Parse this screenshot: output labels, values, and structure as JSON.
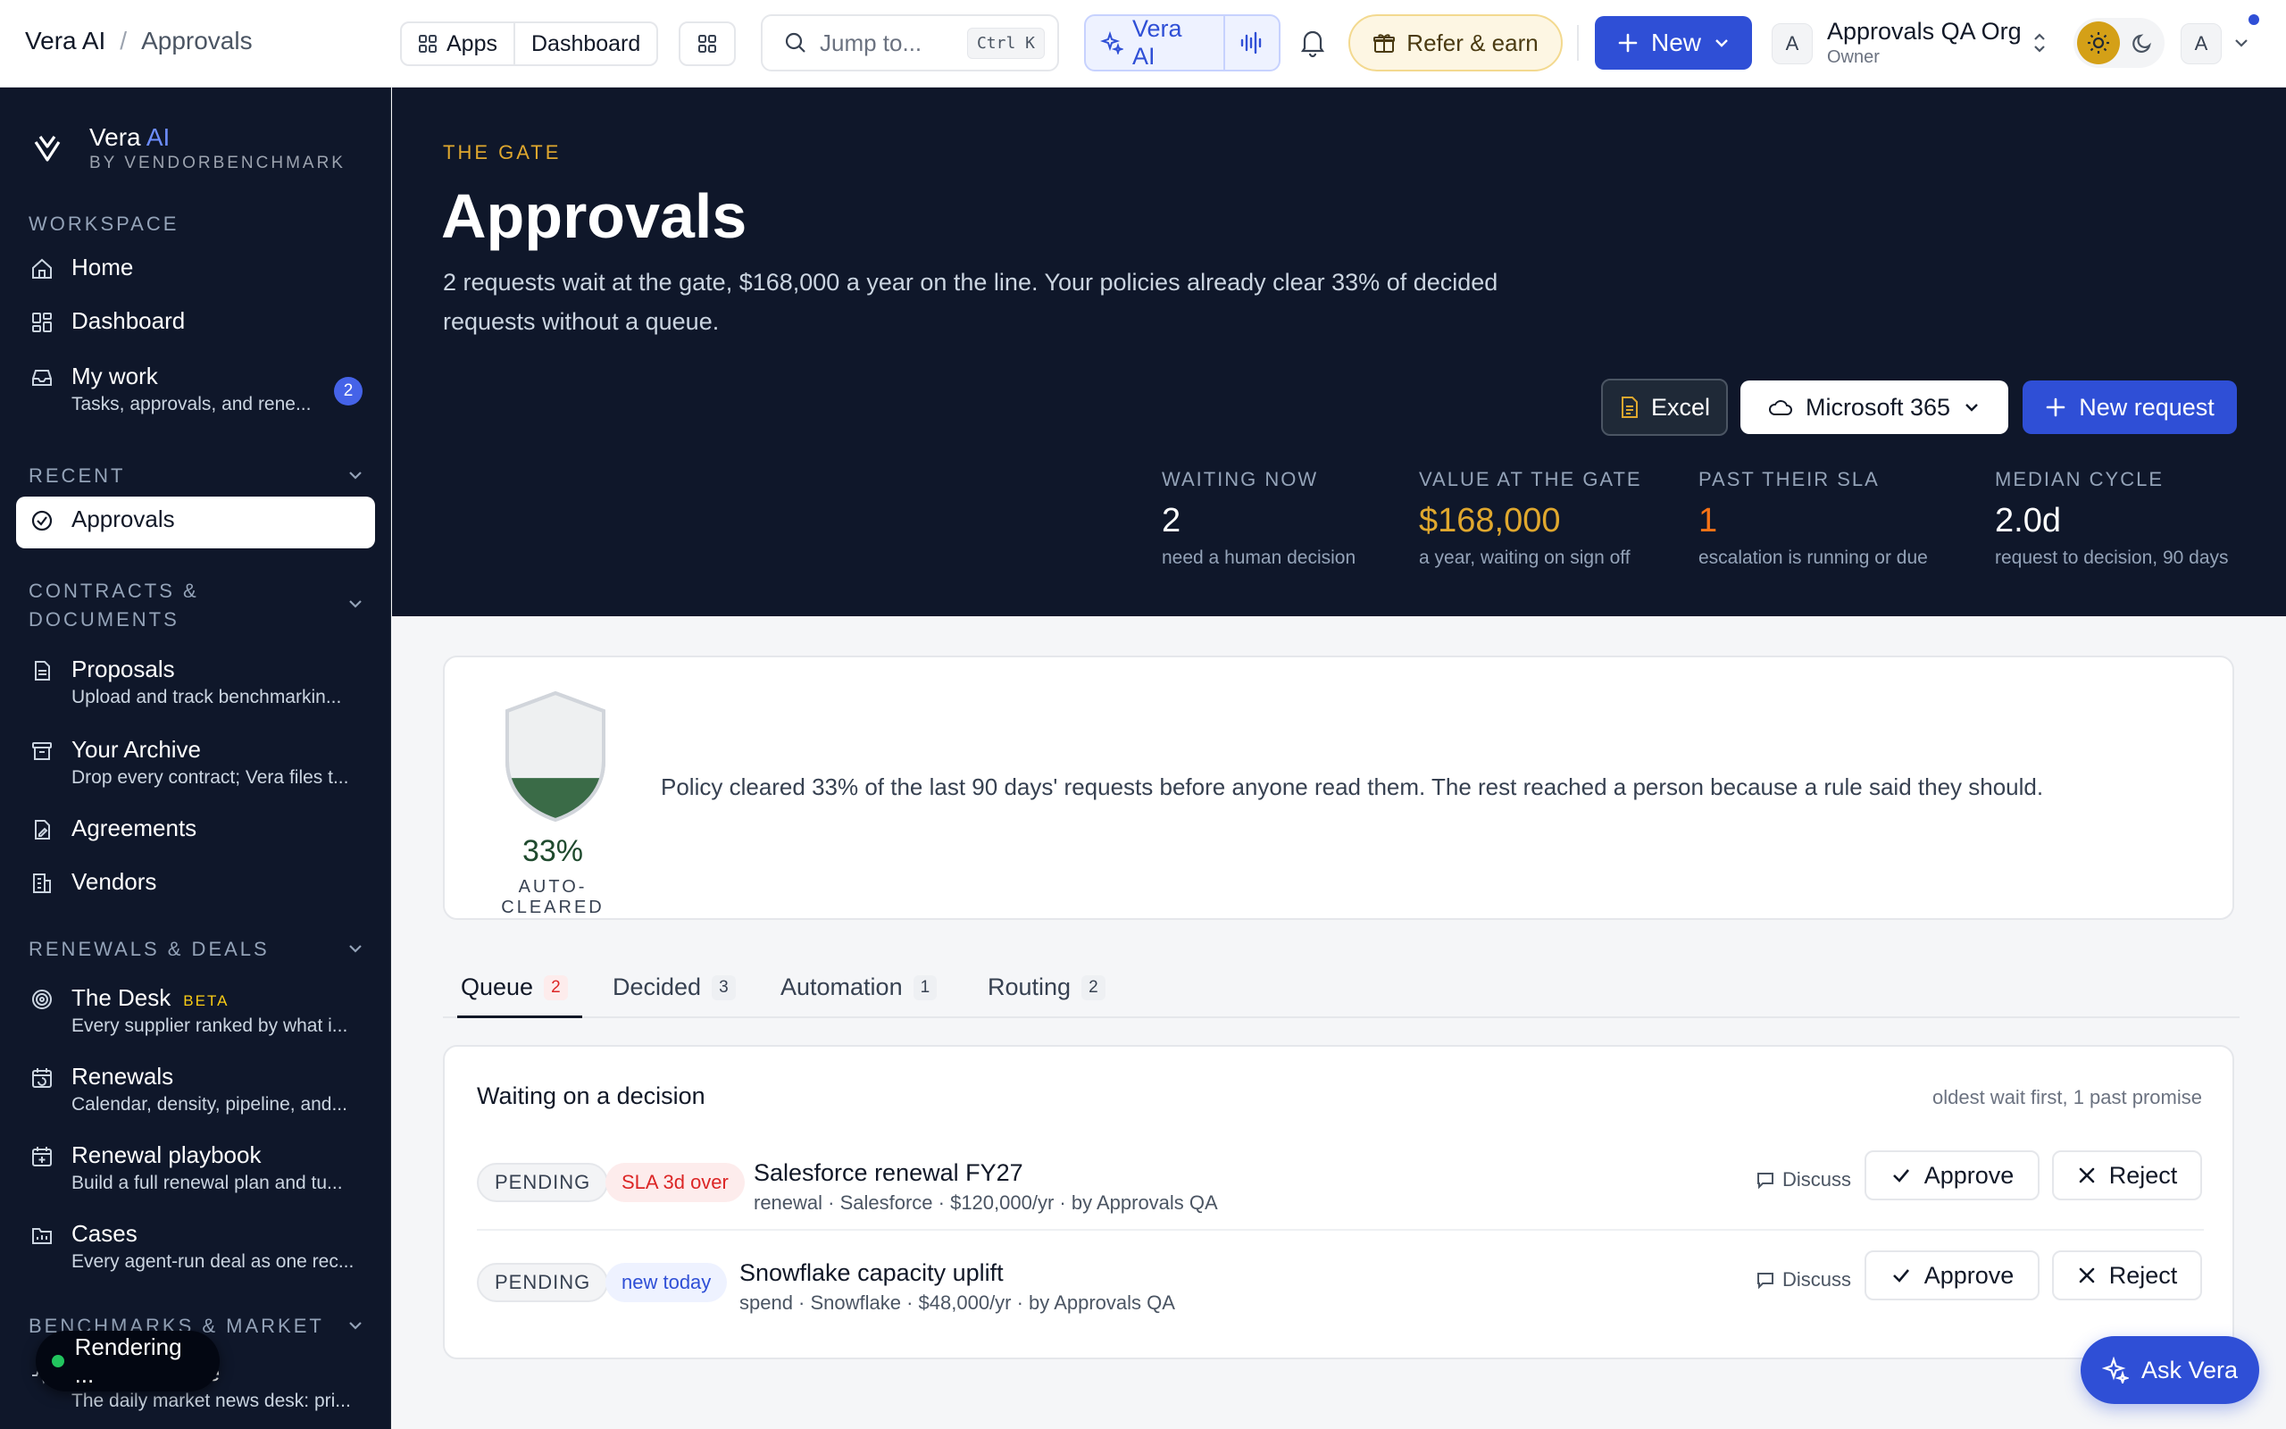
{
  "breadcrumb": {
    "app": "Vera AI",
    "separator": "/",
    "page": "Approvals"
  },
  "topbar": {
    "apps_label": "Apps",
    "dashboard_label": "Dashboard",
    "search_placeholder": "Jump to...",
    "search_shortcut": "Ctrl K",
    "vera_ai_label": "Vera AI",
    "refer_label": "Refer & earn",
    "new_label": "New",
    "org_initial": "A",
    "org_name": "Approvals QA Org",
    "org_role": "Owner",
    "user_initial": "A"
  },
  "sidebar": {
    "brand_name": "Vera",
    "brand_ai": "AI",
    "brand_sub": "BY VENDORBENCHMARK",
    "sections": {
      "workspace": "WORKSPACE",
      "recent": "RECENT",
      "contracts": "CONTRACTS &",
      "contracts2": "DOCUMENTS",
      "renewals": "RENEWALS & DEALS",
      "benchmarks": "BENCHMARKS & MARKET"
    },
    "items": {
      "home": {
        "label": "Home"
      },
      "dashboard": {
        "label": "Dashboard"
      },
      "my_work": {
        "label": "My work",
        "desc": "Tasks, approvals, and rene...",
        "badge": "2"
      },
      "approvals": {
        "label": "Approvals"
      },
      "proposals": {
        "label": "Proposals",
        "desc": "Upload and track benchmarkin..."
      },
      "archive": {
        "label": "Your Archive",
        "desc": "Drop every contract; Vera files t..."
      },
      "agreements": {
        "label": "Agreements"
      },
      "vendors": {
        "label": "Vendors"
      },
      "desk": {
        "label": "The Desk",
        "tag": "BETA",
        "desc": "Every supplier ranked by what i..."
      },
      "renewals": {
        "label": "Renewals",
        "desc": "Calendar, density, pipeline, and..."
      },
      "playbook": {
        "label": "Renewal playbook",
        "desc": "Build a full renewal plan and tu..."
      },
      "cases": {
        "label": "Cases",
        "desc": "Every agent-run deal as one rec..."
      },
      "wire": {
        "label": "The Vera Wire",
        "desc": "The daily market news desk: pri..."
      }
    },
    "rendering_label": "Rendering ..."
  },
  "hero": {
    "eyebrow": "THE GATE",
    "title": "Approvals",
    "lede": "2 requests wait at the gate, $168,000 a year on the line. Your policies already clear 33% of decided requests without a queue.",
    "excel_label": "Excel",
    "ms_label": "Microsoft 365",
    "new_request_label": "New request",
    "stats": {
      "waiting": {
        "label": "WAITING NOW",
        "value": "2",
        "sub": "need a human decision"
      },
      "value": {
        "label": "VALUE AT THE GATE",
        "value": "$168,000",
        "sub": "a year, waiting on sign off"
      },
      "sla": {
        "label": "PAST THEIR SLA",
        "value": "1",
        "sub": "escalation is running or due"
      },
      "cycle": {
        "label": "MEDIAN CYCLE",
        "value": "2.0d",
        "sub": "request to decision, 90 days"
      }
    }
  },
  "policy": {
    "auto_cleared_fraction": 0.33,
    "percent": "33%",
    "label": "AUTO-CLEARED",
    "text": "Policy cleared 33% of the last 90 days' requests before anyone read them. The rest reached a person because a rule said they should."
  },
  "tabs": {
    "queue": {
      "label": "Queue",
      "count": "2"
    },
    "decided": {
      "label": "Decided",
      "count": "3"
    },
    "automation": {
      "label": "Automation",
      "count": "1"
    },
    "routing": {
      "label": "Routing",
      "count": "2"
    }
  },
  "queue": {
    "heading": "Waiting on a decision",
    "subheading": "oldest wait first, 1 past promise",
    "rows": [
      {
        "status": "PENDING",
        "flag": "SLA 3d over",
        "title": "Salesforce renewal FY27",
        "meta": "renewal · Salesforce · $120,000/yr · by Approvals QA",
        "discuss": "Discuss",
        "approve": "Approve",
        "reject": "Reject"
      },
      {
        "status": "PENDING",
        "flag": "new today",
        "title": "Snowflake capacity uplift",
        "meta": "spend · Snowflake · $48,000/yr · by Approvals QA",
        "discuss": "Discuss",
        "approve": "Approve",
        "reject": "Reject"
      }
    ]
  },
  "ask_vera_label": "Ask Vera",
  "colors": {
    "accent": "#2f4fd6",
    "sidebar_bg": "#0f172a",
    "gold": "#e0a82e",
    "danger": "#dc2626",
    "policy_green": "#3a6b47"
  }
}
